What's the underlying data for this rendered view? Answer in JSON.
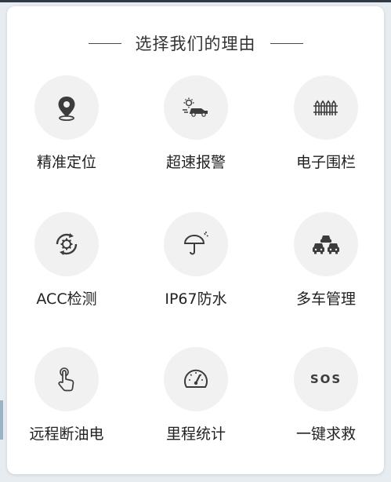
{
  "header": {
    "title": "选择我们的理由"
  },
  "features": [
    {
      "label": "精准定位",
      "icon": "location-pin-icon"
    },
    {
      "label": "超速报警",
      "icon": "speeding-car-icon"
    },
    {
      "label": "电子围栏",
      "icon": "fence-icon"
    },
    {
      "label": "ACC检测",
      "icon": "acc-gear-icon"
    },
    {
      "label": "IP67防水",
      "icon": "umbrella-icon"
    },
    {
      "label": "多车管理",
      "icon": "multi-car-icon"
    },
    {
      "label": "远程断油电",
      "icon": "touch-hand-icon"
    },
    {
      "label": "里程统计",
      "icon": "speedometer-icon"
    },
    {
      "label": "一键求救",
      "icon": "sos-icon",
      "icon_text": "SOS"
    }
  ],
  "colors": {
    "card_background": "#ffffff",
    "icon_circle": "#f1f1f1",
    "icon_stroke": "#3c3c3c",
    "text": "#222222"
  }
}
